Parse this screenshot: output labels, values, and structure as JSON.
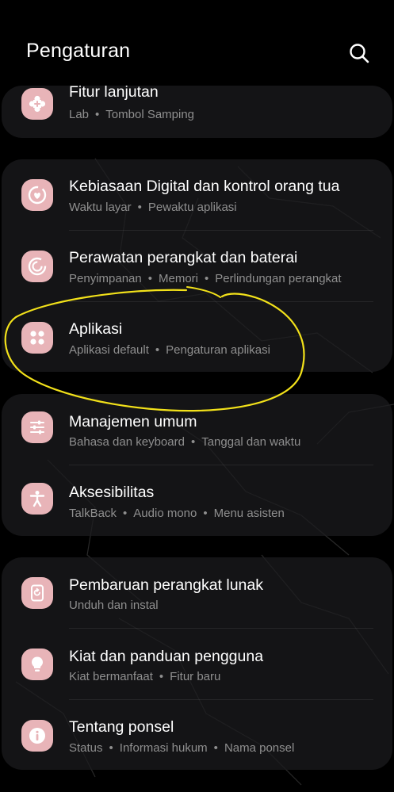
{
  "header": {
    "title": "Pengaturan"
  },
  "groups": [
    {
      "items": [
        {
          "title": "Fitur lanjutan",
          "subs": [
            "Lab",
            "Tombol Samping"
          ]
        }
      ]
    },
    {
      "items": [
        {
          "title": "Kebiasaan Digital dan kontrol orang tua",
          "subs": [
            "Waktu layar",
            "Pewaktu aplikasi"
          ]
        },
        {
          "title": "Perawatan perangkat dan baterai",
          "subs": [
            "Penyimpanan",
            "Memori",
            "Perlindungan perangkat"
          ]
        },
        {
          "title": "Aplikasi",
          "subs": [
            "Aplikasi default",
            "Pengaturan aplikasi"
          ]
        }
      ]
    },
    {
      "items": [
        {
          "title": "Manajemen umum",
          "subs": [
            "Bahasa dan keyboard",
            "Tanggal dan waktu"
          ]
        },
        {
          "title": "Aksesibilitas",
          "subs": [
            "TalkBack",
            "Audio mono",
            "Menu asisten"
          ]
        }
      ]
    },
    {
      "items": [
        {
          "title": "Pembaruan perangkat lunak",
          "subs": [
            "Unduh dan instal"
          ]
        },
        {
          "title": "Kiat dan panduan pengguna",
          "subs": [
            "Kiat bermanfaat",
            "Fitur baru"
          ]
        },
        {
          "title": "Tentang ponsel",
          "subs": [
            "Status",
            "Informasi hukum",
            "Nama ponsel"
          ]
        }
      ]
    }
  ],
  "colors": {
    "icon_bg": "#e8b4b8",
    "icon_fg": "#ffffff",
    "annotation": "#f2e11a"
  }
}
